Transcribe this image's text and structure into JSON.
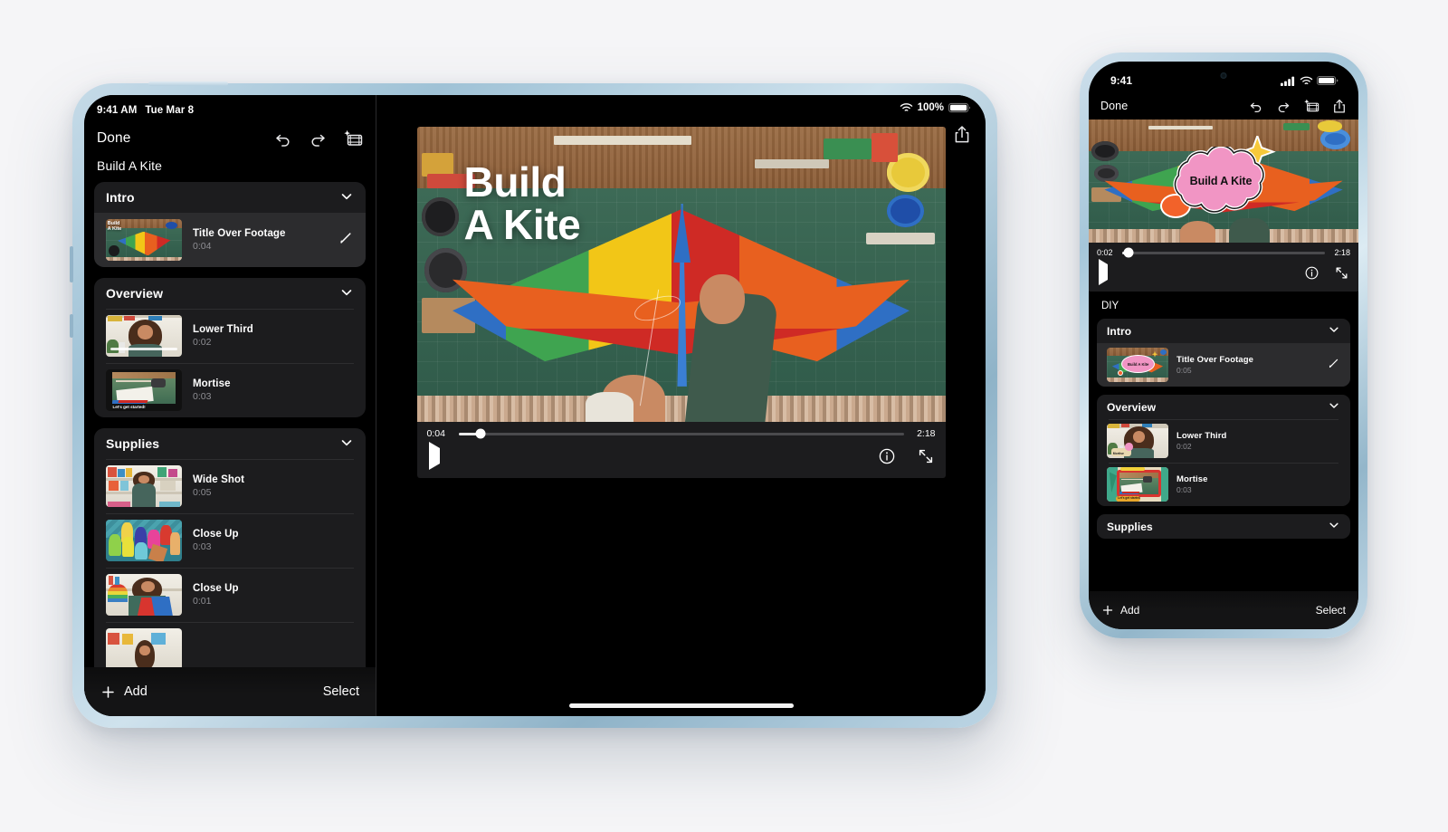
{
  "scene": {
    "background_color": "#f5f5f7",
    "devices": [
      "ipad",
      "iphone"
    ]
  },
  "ipad": {
    "device_name": "iPad Air",
    "frame_color": "#a5c6d9",
    "status_bar": {
      "time": "9:41 AM",
      "date": "Tue Mar 8",
      "wifi_icon": "wifi-icon",
      "battery_percent": "100%",
      "battery_icon": "battery-full-icon"
    },
    "nav_bar": {
      "done_label": "Done",
      "icons": [
        "undo-icon",
        "redo-icon",
        "magic-movie-icon"
      ],
      "share_icon": "share-icon"
    },
    "project_title": "Build A Kite",
    "groups": [
      {
        "label": "Intro",
        "chevron": "chevron-down-icon",
        "clips": [
          {
            "title": "Title Over Footage",
            "duration": "0:04",
            "selected": true,
            "edit_icon": "pencil-icon",
            "thumb": "kite-title-card"
          }
        ]
      },
      {
        "label": "Overview",
        "chevron": "chevron-down-icon",
        "clips": [
          {
            "title": "Lower Third",
            "duration": "0:02",
            "selected": false,
            "thumb": "woman-kitchen"
          },
          {
            "title": "Mortise",
            "duration": "0:03",
            "selected": false,
            "thumb": "desk-overhead-caption"
          }
        ]
      },
      {
        "label": "Supplies",
        "chevron": "chevron-down-icon",
        "clips": [
          {
            "title": "Wide Shot",
            "duration": "0:05",
            "selected": false,
            "thumb": "woman-craft-shelves"
          },
          {
            "title": "Close Up",
            "duration": "0:03",
            "selected": false,
            "thumb": "colorful-bottles"
          },
          {
            "title": "Close Up",
            "duration": "0:01",
            "selected": false,
            "thumb": "woman-holding-paper"
          },
          {
            "title": "",
            "duration": "",
            "selected": false,
            "thumb": "craft-room-partial"
          }
        ]
      }
    ],
    "bottom_bar": {
      "add_label": "Add",
      "add_icon": "plus-icon",
      "select_label": "Select"
    },
    "player": {
      "overlay_title_line1": "Build",
      "overlay_title_line2": "A Kite",
      "current_time": "0:04",
      "total_time": "2:18",
      "progress_percent": 5,
      "play_icon": "play-icon",
      "info_icon": "info-circle-icon",
      "fullscreen_icon": "expand-icon"
    }
  },
  "iphone": {
    "device_name": "iPhone 13 Pro",
    "frame_color": "#a5c6d9",
    "status_bar": {
      "time": "9:41",
      "cellular_icon": "cellular-bars-icon",
      "wifi_icon": "wifi-icon",
      "battery_icon": "battery-full-icon"
    },
    "nav_bar": {
      "done_label": "Done",
      "icons": [
        "undo-icon",
        "redo-icon",
        "magic-movie-icon",
        "share-icon"
      ]
    },
    "player": {
      "callout_text": "Build A Kite",
      "current_time": "0:02",
      "total_time": "2:18",
      "progress_percent": 3,
      "play_icon": "play-icon",
      "info_icon": "info-circle-icon",
      "fullscreen_icon": "expand-icon"
    },
    "project_title": "DIY",
    "groups": [
      {
        "label": "Intro",
        "chevron": "chevron-down-icon",
        "clips": [
          {
            "title": "Title Over Footage",
            "duration": "0:05",
            "selected": true,
            "edit_icon": "pencil-icon",
            "thumb": "kite-cloud-title"
          }
        ]
      },
      {
        "label": "Overview",
        "chevron": "chevron-down-icon",
        "clips": [
          {
            "title": "Lower Third",
            "duration": "0:02",
            "selected": false,
            "thumb": "woman-kitchen-lowerthird"
          },
          {
            "title": "Mortise",
            "duration": "0:03",
            "selected": false,
            "thumb": "desk-overhead-framed"
          }
        ]
      },
      {
        "label": "Supplies",
        "chevron": "chevron-down-icon",
        "clips": []
      }
    ],
    "bottom_bar": {
      "add_label": "Add",
      "add_icon": "plus-icon",
      "select_label": "Select"
    }
  }
}
